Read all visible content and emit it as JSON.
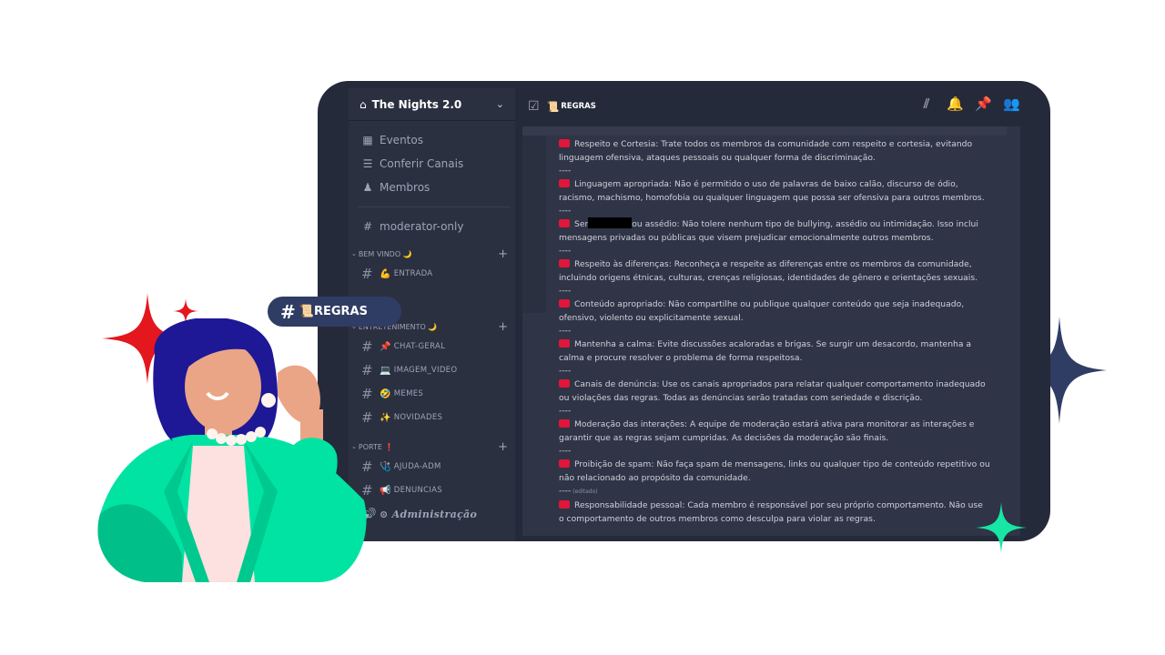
{
  "server": {
    "name": "The Nights 2.0",
    "icon": "server-icon",
    "chevron": "⌄"
  },
  "sidebar": {
    "top_items": [
      {
        "icon": "calendar-icon",
        "label": "Eventos"
      },
      {
        "icon": "browse-channels-icon",
        "label": "Conferir Canais"
      },
      {
        "icon": "members-icon",
        "label": "Membros"
      }
    ],
    "moderator": "moderator-only",
    "categories": [
      {
        "label": "BEM VINDO 🌙",
        "channels": [
          {
            "emoji": "💪",
            "label": "ENTRADA"
          }
        ]
      },
      {
        "label": "ENTRETENIMENTO 🌙",
        "channels": [
          {
            "emoji": "📌",
            "label": "CHAT-GERAL"
          },
          {
            "emoji": "💻",
            "label": "IMAGEM_VIDEO"
          },
          {
            "emoji": "🤣",
            "label": "MEMES"
          },
          {
            "emoji": "✨",
            "label": "NOVIDADES"
          }
        ]
      },
      {
        "label": "PORTE ❗",
        "channels": [
          {
            "emoji": "🩺",
            "label": "AJUDA-ADM"
          },
          {
            "emoji": "📢",
            "label": "DENUNCIAS"
          }
        ]
      }
    ],
    "admin_channel": "⊙ 𝑨𝒅𝒎𝒊𝒏𝒊𝒔𝒕𝒓𝒂çã𝒐"
  },
  "channel": {
    "emoji": "📜",
    "name": "REGRAS"
  },
  "tag": {
    "hash": "#",
    "emoji": "📜",
    "label": "REGRAS"
  },
  "rules": [
    {
      "title": "Respeito e Cortesia:",
      "lines": [
        "Respeito e Cortesia: Trate todos os membros da comunidade com respeito e cortesia, evitando",
        "linguagem ofensiva, ataques pessoais ou qualquer forma de discriminação."
      ]
    },
    {
      "lines": [
        "Linguagem apropriada: Não é permitido o uso de palavras de baixo calão, discurso de ódio,",
        "racismo, machismo, homofobia ou qualquer linguagem que possa ser ofensiva para outros membros."
      ]
    },
    {
      "pre": "Ser",
      "post": "ou assédio: Não tolere nenhum tipo de bullying, assédio ou intimidação. Isso inclui",
      "lines2": "mensagens privadas ou públicas que visem prejudicar emocionalmente outros membros."
    },
    {
      "lines": [
        "Respeito às diferenças: Reconheça e respeite as diferenças entre os membros da comunidade,",
        "incluindo origens étnicas, culturas, crenças religiosas, identidades de gênero e orientações sexuais."
      ]
    },
    {
      "lines": [
        "Conteúdo apropriado: Não compartilhe ou publique qualquer conteúdo que seja inadequado,",
        "ofensivo, violento ou explicitamente sexual."
      ]
    },
    {
      "lines": [
        "Mantenha a calma: Evite discussões acaloradas e brigas. Se surgir um desacordo, mantenha a",
        "calma e procure resolver o problema de forma respeitosa."
      ]
    },
    {
      "lines": [
        "Canais de denúncia: Use os canais apropriados para relatar qualquer comportamento inadequado",
        "ou violações das regras. Todas as denúncias serão tratadas com seriedade e discrição."
      ]
    },
    {
      "lines": [
        "Moderação das interações: A equipe de moderação estará ativa para monitorar as interações e",
        "garantir que as regras sejam cumpridas. As decisões da moderação são finais."
      ]
    },
    {
      "lines": [
        "Proibição de spam: Não faça spam de mensagens, links ou qualquer tipo de conteúdo repetitivo ou",
        "não relacionado ao propósito da comunidade."
      ]
    },
    {
      "lines": [
        "Responsabilidade pessoal: Cada membro é responsável por seu próprio comportamento. Não use",
        "o comportamento de outros membros como desculpa para violar as regras."
      ]
    }
  ],
  "separator": "----",
  "edited_label": "(editado)",
  "colors": {
    "window": "#252a3a",
    "sidebar": "#2b3040",
    "messages": "#2f3446",
    "rule_dot": "#e0163a",
    "tag": "#2f3c64"
  }
}
